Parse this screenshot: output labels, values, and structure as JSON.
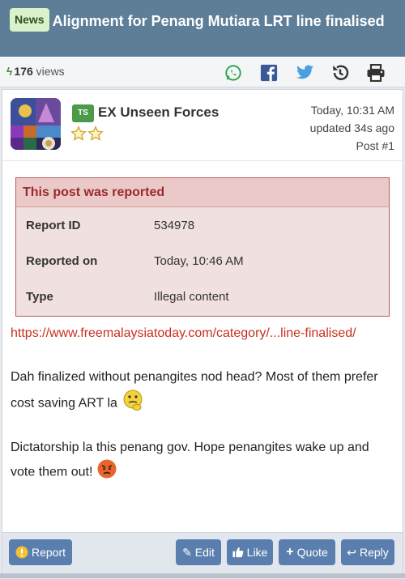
{
  "thread": {
    "badge": "News",
    "title": "Alignment for Penang Mutiara LRT line finalised"
  },
  "stats": {
    "views_count": "176",
    "views_label": "views"
  },
  "share": {
    "icons": [
      "whatsapp-icon",
      "facebook-icon",
      "twitter-icon",
      "history-icon",
      "print-icon"
    ],
    "colors": {
      "whatsapp": "#25a244",
      "facebook": "#3b5998",
      "twitter": "#4a9fe0",
      "history": "#333333",
      "print": "#333333"
    }
  },
  "post": {
    "author_badge": "TS",
    "author": "EX Unseen Forces",
    "rank_stars": 2,
    "time": "Today, 10:31 AM",
    "updated": "updated 34s ago",
    "post_number": "Post #1"
  },
  "report": {
    "title": "This post was reported",
    "rows": [
      {
        "key": "Report ID",
        "value": "534978"
      },
      {
        "key": "Reported on",
        "value": "Today, 10:46 AM"
      },
      {
        "key": "Type",
        "value": "Illegal content"
      }
    ]
  },
  "body": {
    "link_text": "https://www.freemalaysiatoday.com/category/...line-finalised/",
    "para1": "Dah finalized without penangites nod head? Most of them prefer cost saving ART la",
    "para2": "Dictatorship la this penang gov. Hope penangites wake up and vote them out!"
  },
  "actions": {
    "report": "Report",
    "edit": "Edit",
    "like": "Like",
    "quote": "Quote",
    "reply": "Reply"
  },
  "colors": {
    "header_bg": "#5e7e98",
    "button_bg": "#5a7fae",
    "report_title": "#9a2a2a",
    "link": "#c8301f"
  }
}
